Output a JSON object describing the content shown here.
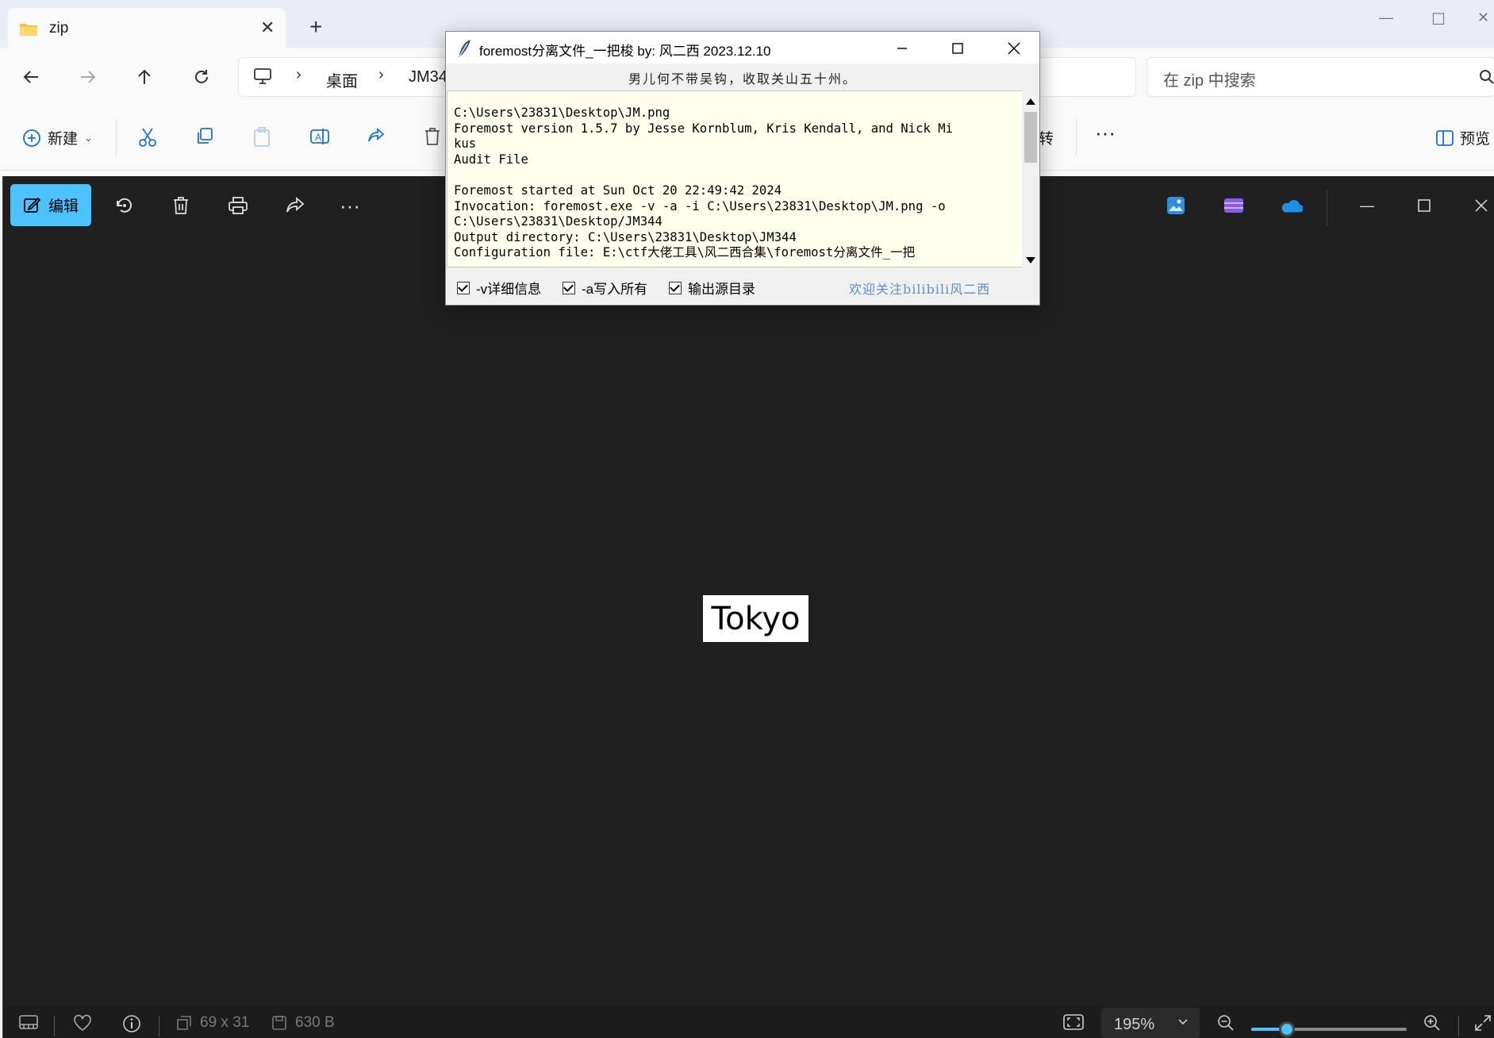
{
  "explorer": {
    "tab_title": "zip",
    "breadcrumb": [
      "桌面",
      "JM34"
    ],
    "search_placeholder": "在 zip 中搜索",
    "new_label": "新建",
    "rotate_label": "转",
    "preview_label": "预览"
  },
  "photos": {
    "edit_label": "编辑",
    "image_text": "Tokyo",
    "status": {
      "dimensions": "69 x 31",
      "size": "630 B",
      "zoom": "195%",
      "zoom_fraction": 0.23
    }
  },
  "dialog": {
    "title": "foremost分离文件_一把梭  by: 风二西 2023.12.10",
    "slogan": "男儿何不带吴钩，收取关山五十州。",
    "console_lines": [
      "C:\\Users\\23831\\Desktop\\JM.png",
      "Foremost version 1.5.7 by Jesse Kornblum, Kris Kendall, and Nick Mi",
      "kus",
      "Audit File",
      "",
      "Foremost started at Sun Oct 20 22:49:42 2024",
      "Invocation: foremost.exe -v -a -i C:\\Users\\23831\\Desktop\\JM.png -o",
      "C:\\Users\\23831\\Desktop/JM344",
      "Output directory: C:\\Users\\23831\\Desktop\\JM344",
      "Configuration file: E:\\ctf大佬工具\\风二西合集\\foremost分离文件_一把"
    ],
    "options": [
      {
        "label": "-v详细信息",
        "checked": true
      },
      {
        "label": "-a写入所有",
        "checked": true
      },
      {
        "label": "输出源目录",
        "checked": true
      }
    ],
    "welcome": "欢迎关注bilibili风二西"
  },
  "colors": {
    "accent": "#4cc2ff",
    "viewer_bg": "#202020",
    "console_bg": "#ffffed"
  }
}
